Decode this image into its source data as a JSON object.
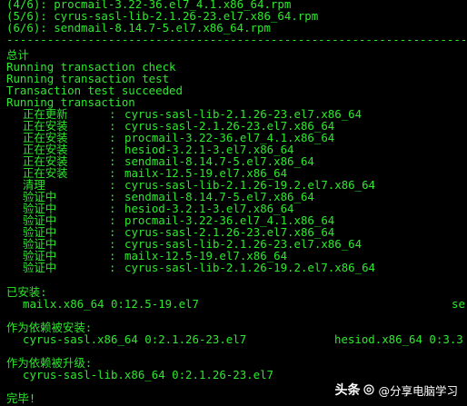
{
  "terminal": {
    "colors": {
      "background": "#000000",
      "text": "#2ee82e",
      "watermark": "#ffffff"
    },
    "download_lines": [
      "(4/6): procmail-3.22-36.el7_4.1.x86_64.rpm",
      "(5/6): cyrus-sasl-lib-2.1.26-23.el7.x86_64.rpm",
      "(6/6): sendmail-8.14.7-5.el7.x86_64.rpm"
    ],
    "separator": "--------------------------------------------------------------------------------",
    "summary_label": "总计",
    "check_lines": [
      "Running transaction check",
      "Running transaction test",
      "Transaction test succeeded",
      "Running transaction"
    ],
    "transaction_steps": [
      {
        "action": "正在更新",
        "package": "cyrus-sasl-lib-2.1.26-23.el7.x86_64"
      },
      {
        "action": "正在安装",
        "package": "cyrus-sasl-2.1.26-23.el7.x86_64"
      },
      {
        "action": "正在安装",
        "package": "procmail-3.22-36.el7_4.1.x86_64"
      },
      {
        "action": "正在安装",
        "package": "hesiod-3.2.1-3.el7.x86_64"
      },
      {
        "action": "正在安装",
        "package": "sendmail-8.14.7-5.el7.x86_64"
      },
      {
        "action": "正在安装",
        "package": "mailx-12.5-19.el7.x86_64"
      },
      {
        "action": "清理",
        "package": "cyrus-sasl-lib-2.1.26-19.2.el7.x86_64"
      },
      {
        "action": "验证中",
        "package": "sendmail-8.14.7-5.el7.x86_64"
      },
      {
        "action": "验证中",
        "package": "hesiod-3.2.1-3.el7.x86_64"
      },
      {
        "action": "验证中",
        "package": "procmail-3.22-36.el7_4.1.x86_64"
      },
      {
        "action": "验证中",
        "package": "cyrus-sasl-2.1.26-23.el7.x86_64"
      },
      {
        "action": "验证中",
        "package": "cyrus-sasl-lib-2.1.26-23.el7.x86_64"
      },
      {
        "action": "验证中",
        "package": "mailx-12.5-19.el7.x86_64"
      },
      {
        "action": "验证中",
        "package": "cyrus-sasl-lib-2.1.26-19.2.el7.x86_64"
      }
    ],
    "step_separator": ":",
    "installed": {
      "heading": "已安装:",
      "package": "mailx.x86_64 0:12.5-19.el7",
      "cut_off": "se"
    },
    "dependency_installed": {
      "heading": "作为依赖被安装:",
      "packages": [
        "cyrus-sasl.x86_64 0:2.1.26-23.el7",
        "hesiod.x86_64 0:3.3"
      ]
    },
    "dependency_upgraded": {
      "heading": "作为依赖被升级:",
      "package": "cyrus-sasl-lib.x86_64 0:2.1.26-23.el7"
    },
    "complete": "完毕!"
  },
  "watermark": {
    "brand": "头条",
    "icon": "at-sign-icon",
    "account": "@分享电脑学习"
  }
}
